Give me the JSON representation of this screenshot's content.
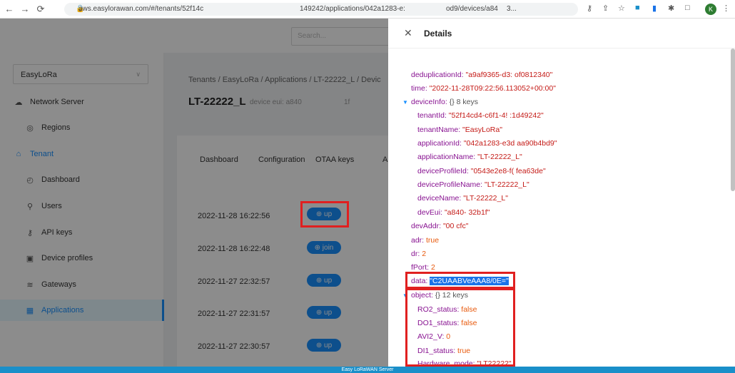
{
  "browser": {
    "url_parts": [
      "aws.easylorawan.com/#/tenants/52f14c",
      "149242/applications/042a1283-e:",
      "od9/devices/a84",
      "3..."
    ],
    "avatar_letter": "K"
  },
  "header": {
    "search_placeholder": "Search..."
  },
  "sidebar": {
    "tenant_select": "EasyLoRa",
    "items": [
      {
        "label": "Network Server",
        "icon": "cloud-icon"
      },
      {
        "label": "Regions",
        "icon": "compass-icon"
      },
      {
        "label": "Tenant",
        "icon": "home-icon"
      },
      {
        "label": "Dashboard",
        "icon": "dashboard-icon"
      },
      {
        "label": "Users",
        "icon": "user-icon"
      },
      {
        "label": "API keys",
        "icon": "key-icon"
      },
      {
        "label": "Device profiles",
        "icon": "profile-icon"
      },
      {
        "label": "Gateways",
        "icon": "wifi-icon"
      },
      {
        "label": "Applications",
        "icon": "apps-icon"
      }
    ]
  },
  "main": {
    "breadcrumb": "Tenants / EasyLoRa / Applications / LT-22222_L / Devic",
    "title": "LT-22222_L",
    "subtitle": "device eui: a840",
    "subtitle2": "1f",
    "tabs": [
      "Dashboard",
      "Configuration",
      "OTAA keys",
      "A"
    ],
    "events": [
      {
        "time": "2022-11-28 16:22:56",
        "tag": "up"
      },
      {
        "time": "2022-11-28 16:22:48",
        "tag": "join"
      },
      {
        "time": "2022-11-27 22:32:57",
        "tag": "up"
      },
      {
        "time": "2022-11-27 22:31:57",
        "tag": "up"
      },
      {
        "time": "2022-11-27 22:30:57",
        "tag": "up"
      }
    ]
  },
  "drawer": {
    "title": "Details",
    "json": {
      "deduplicationId": {
        "key": "deduplicationId:",
        "val": "\"a9af9365-d3:                    of0812340\""
      },
      "time": {
        "key": "time:",
        "val": "\"2022-11-28T09:22:56.113052+00:00\""
      },
      "deviceInfo": {
        "key": "deviceInfo:",
        "meta": "{}  8 keys"
      },
      "tenantId": {
        "key": "tenantId:",
        "val": "\"52f14cd4-c6f1-4!                    :1d49242\""
      },
      "tenantName": {
        "key": "tenantName:",
        "val": "\"EasyLoRa\""
      },
      "applicationId": {
        "key": "applicationId:",
        "val": "\"042a1283-e3d                    aa90b4bd9\""
      },
      "applicationName": {
        "key": "applicationName:",
        "val": "\"LT-22222_L\""
      },
      "deviceProfileId": {
        "key": "deviceProfileId:",
        "val": "\"0543e2e8-f(                         fea63de\""
      },
      "deviceProfileName": {
        "key": "deviceProfileName:",
        "val": "\"LT-22222_L\""
      },
      "deviceName": {
        "key": "deviceName:",
        "val": "\"LT-22222_L\""
      },
      "devEui": {
        "key": "devEui:",
        "val": "\"a840-          32b1f\""
      },
      "devAddr": {
        "key": "devAddr:",
        "val": "\"00    cfc\""
      },
      "adr": {
        "key": "adr:",
        "val": "true"
      },
      "dr": {
        "key": "dr:",
        "val": "2"
      },
      "fPort": {
        "key": "fPort:",
        "val": "2"
      },
      "data": {
        "key": "data:",
        "val": "\"C2UAABVeAAA8/0E=\""
      },
      "object": {
        "key": "object:",
        "meta": "{}  12 keys"
      },
      "RO2_status": {
        "key": "RO2_status:",
        "val": "false"
      },
      "DO1_status": {
        "key": "DO1_status:",
        "val": "false"
      },
      "AVI2_V": {
        "key": "AVI2_V:",
        "val": "0"
      },
      "DI1_status": {
        "key": "DI1_status:",
        "val": "true"
      },
      "Hardware_mode": {
        "key": "Hardware_mode:",
        "val": "\"LT22222\""
      }
    }
  },
  "footer": {
    "text": "Easy LoRaWAN Server"
  }
}
